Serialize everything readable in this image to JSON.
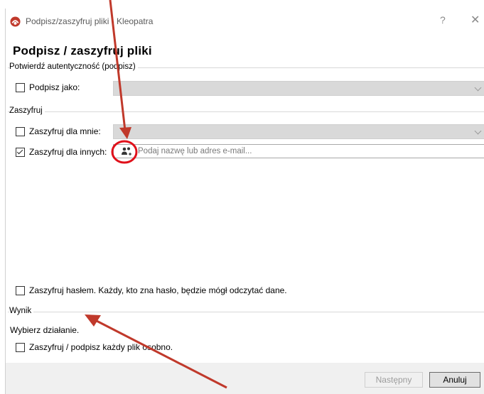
{
  "window": {
    "title": "Podpisz/zaszyfruj pliki - Kleopatra",
    "help_glyph": "?",
    "close_glyph": "✕"
  },
  "page_heading": "Podpisz / zaszyfruj pliki",
  "sign_group": {
    "title": "Potwierdź autentyczność (podpisz)",
    "sign_as_label": "Podpisz jako:",
    "sign_as_checked": false
  },
  "encrypt_group": {
    "title": "Zaszyfruj",
    "for_me_label": "Zaszyfruj dla mnie:",
    "for_me_checked": false,
    "for_others_label": "Zaszyfruj dla innych:",
    "for_others_checked": true,
    "recipient_placeholder": "Podaj nazwę lub adres e-mail...",
    "password_label": "Zaszyfruj hasłem. Każdy, kto zna hasło, będzie mógł odczytać dane.",
    "password_checked": false
  },
  "result_group": {
    "title": "Wynik",
    "choose_action": "Wybierz działanie.",
    "each_file_label": "Zaszyfruj / podpisz każdy plik osobno.",
    "each_file_checked": false
  },
  "buttons": {
    "next": "Następny",
    "cancel": "Anuluj"
  },
  "colors": {
    "annotation": "#c0392b",
    "circle": "#e0101a"
  }
}
